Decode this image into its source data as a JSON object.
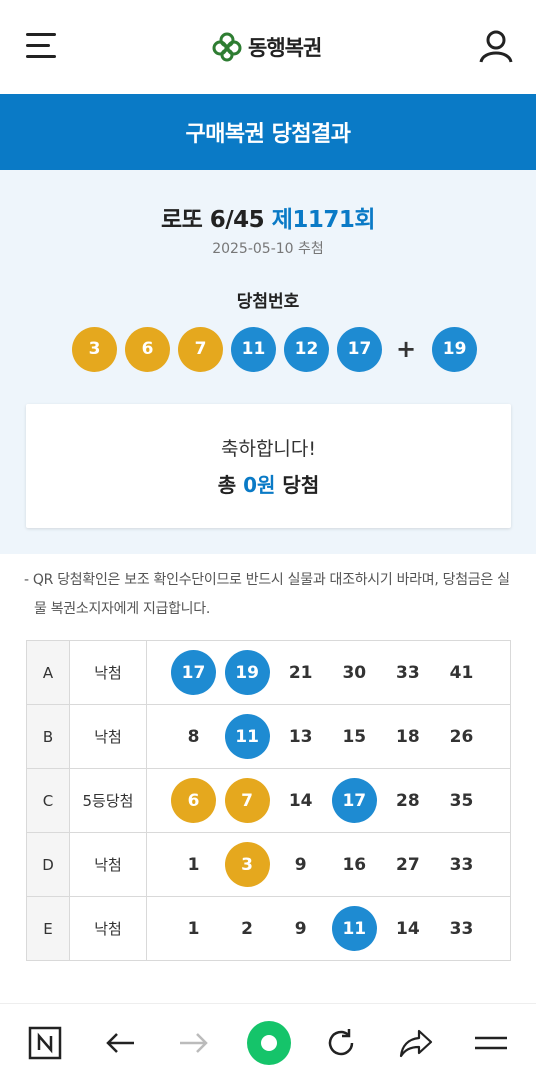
{
  "header": {
    "menu_icon": "hamburger-menu-icon",
    "logo_text": "동행복권",
    "user_icon": "user-icon"
  },
  "page_title": "구매복권 당첨결과",
  "draw": {
    "game": "로또 6/45",
    "round": "제1171회",
    "date": "2025-05-10 추첨",
    "winning_label": "당첨번호",
    "winning_numbers": [
      "3",
      "6",
      "7",
      "11",
      "12",
      "17"
    ],
    "bonus_symbol": "+",
    "bonus_number": "19"
  },
  "result": {
    "message": "축하합니다!",
    "prize_prefix": "총",
    "prize_amount": "0원",
    "prize_suffix": "당첨"
  },
  "notice": "- QR 당첨확인은 보조 확인수단이므로 반드시 실물과 대조하시기 바라며, 당첨금은 실물 복권소지자에게 지급합니다.",
  "tickets": [
    {
      "game": "A",
      "status": "낙첨",
      "numbers": [
        "17",
        "19",
        "21",
        "30",
        "33",
        "41"
      ]
    },
    {
      "game": "B",
      "status": "낙첨",
      "numbers": [
        "8",
        "11",
        "13",
        "15",
        "18",
        "26"
      ]
    },
    {
      "game": "C",
      "status": "5등당첨",
      "numbers": [
        "6",
        "7",
        "14",
        "17",
        "28",
        "35"
      ]
    },
    {
      "game": "D",
      "status": "낙첨",
      "numbers": [
        "1",
        "3",
        "9",
        "16",
        "27",
        "33"
      ]
    },
    {
      "game": "E",
      "status": "낙첨",
      "numbers": [
        "1",
        "2",
        "9",
        "11",
        "14",
        "33"
      ]
    }
  ],
  "ball_colors": {
    "yellow": "#e5a81e",
    "blue": "#1e8bd2"
  },
  "bottom_nav": [
    "naver-n-icon",
    "back-arrow-icon",
    "forward-arrow-icon",
    "home-green-icon",
    "refresh-icon",
    "share-icon",
    "more-menu-icon"
  ]
}
